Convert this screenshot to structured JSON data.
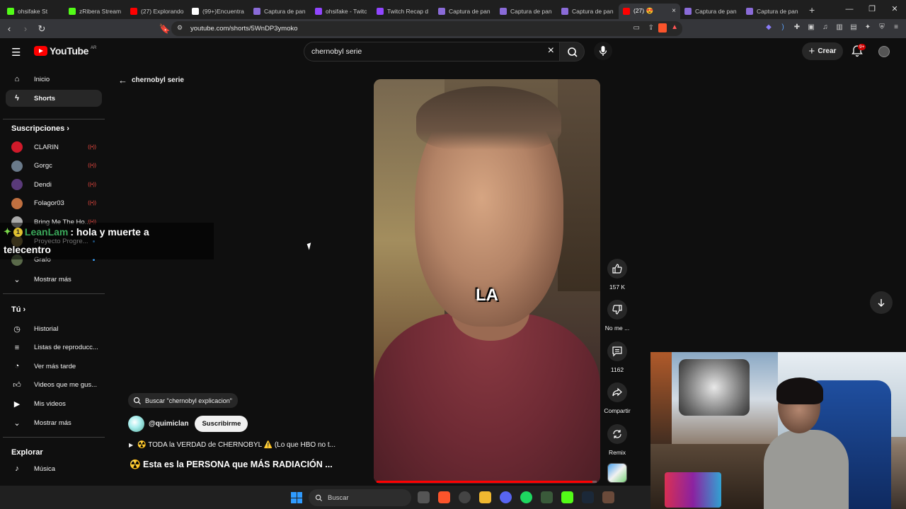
{
  "browser": {
    "tabs": [
      {
        "title": "ohsifake St",
        "color": "#53fc18",
        "active": false
      },
      {
        "title": "zRibera Stream",
        "color": "#53fc18",
        "active": false
      },
      {
        "title": "(27) Explorando",
        "color": "#ff0000",
        "active": false
      },
      {
        "title": "(99+)Encuentra",
        "color": "#ffffff",
        "active": false
      },
      {
        "title": "Captura de pan",
        "color": "#8a6bd8",
        "active": false
      },
      {
        "title": "ohsifake - Twitc",
        "color": "#9146ff",
        "active": false
      },
      {
        "title": "Twitch Recap d",
        "color": "#9146ff",
        "active": false
      },
      {
        "title": "Captura de pan",
        "color": "#8a6bd8",
        "active": false
      },
      {
        "title": "Captura de pan",
        "color": "#8a6bd8",
        "active": false
      },
      {
        "title": "Captura de pan",
        "color": "#8a6bd8",
        "active": false
      },
      {
        "title": "(27) 😍",
        "color": "#ff0000",
        "active": true
      },
      {
        "title": "Captura de pan",
        "color": "#8a6bd8",
        "active": false
      },
      {
        "title": "Captura de pan",
        "color": "#8a6bd8",
        "active": false
      }
    ],
    "url": "youtube.com/shorts/5WnDP3ymoko"
  },
  "youtube": {
    "logo_text": "YouTube",
    "country": "AR",
    "search_query": "chernobyl serie",
    "create_label": "Crear",
    "notifications_badge": "9+",
    "back_label": "chernobyl serie"
  },
  "sidebar": {
    "main": [
      {
        "label": "Inicio",
        "icon": "home-icon",
        "selected": false
      },
      {
        "label": "Shorts",
        "icon": "shorts-icon",
        "selected": true
      }
    ],
    "subscriptions_title": "Suscripciones",
    "subscriptions": [
      {
        "label": "CLARIN",
        "status": "live",
        "avatar_color": "#d01a2a"
      },
      {
        "label": "Gorgc",
        "status": "live",
        "avatar_color": "#6a7a8a"
      },
      {
        "label": "Dendi",
        "status": "live",
        "avatar_color": "#5a3a7a"
      },
      {
        "label": "Folagor03",
        "status": "live",
        "avatar_color": "#c07040"
      },
      {
        "label": "Bring Me The Ho...",
        "status": "live",
        "avatar_color": "#aaaaaa"
      },
      {
        "label": "Proyecto Progre...",
        "status": "new",
        "avatar_color": "#7a6a3a"
      },
      {
        "label": "Grafo",
        "status": "new",
        "avatar_color": "#5a6a4a"
      }
    ],
    "show_more_1": "Mostrar más",
    "you_title": "Tú",
    "you_items": [
      {
        "label": "Historial",
        "icon": "history-icon"
      },
      {
        "label": "Listas de reproducc...",
        "icon": "playlists-icon"
      },
      {
        "label": "Ver más tarde",
        "icon": "watch-later-icon"
      },
      {
        "label": "Videos que me gus...",
        "icon": "liked-videos-icon"
      },
      {
        "label": "Mis videos",
        "icon": "your-videos-icon"
      }
    ],
    "show_more_2": "Mostrar más",
    "explore_title": "Explorar",
    "explore_items": [
      {
        "label": "Música",
        "icon": "music-icon"
      }
    ]
  },
  "short": {
    "caption": "LA",
    "progress_fraction": 0.98,
    "search_pill": "Buscar \"chernobyl explicacion\"",
    "channel": "@quimiclan",
    "subscribe_label": "Suscribirme",
    "playlist_text": "☢️ TODA la VERDAD de CHERNOBYL ⚠️ (Lo que HBO no t...",
    "title": "☢️ Esta es la PERSONA que MÁS RADIACIÓN ..."
  },
  "actions": {
    "likes": "157 K",
    "dislike": "No me ...",
    "comments": "1162",
    "share": "Compartir",
    "remix": "Remix"
  },
  "chat_overlay": {
    "user": "LeanLam",
    "badge": "1",
    "message_line1": ": hola y muerte a",
    "message_line2": "telecentro"
  },
  "taskbar": {
    "search_label": "Buscar"
  }
}
